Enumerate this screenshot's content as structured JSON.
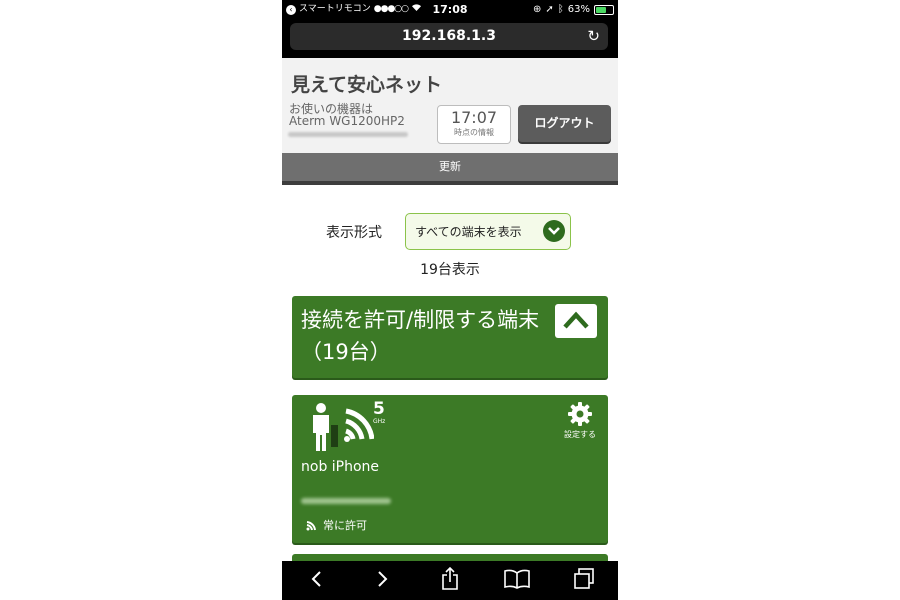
{
  "status_bar": {
    "back_app": "スマートリモコン",
    "signal": "●●●○○",
    "time": "17:08",
    "battery": "63%",
    "battery_level": 0.63
  },
  "address_bar": {
    "url": "192.168.1.3"
  },
  "header": {
    "title": "見えて安心ネット",
    "device_label": "お使いの機器は",
    "device_name": "Aterm WG1200HP2",
    "info_time": "17:07",
    "info_caption": "時点の情報",
    "logout_label": "ログアウト",
    "update_label": "更新"
  },
  "display": {
    "format_label": "表示形式",
    "format_value": "すべての端末を表示",
    "count_text": "19台表示"
  },
  "section": {
    "title": "接続を許可/制限する端末（19台）"
  },
  "device_card": {
    "band": "5",
    "band_unit": "GHz",
    "settings_label": "設定する",
    "name": "nob iPhone",
    "status": "常に許可"
  },
  "colors": {
    "green": "#3c7a26",
    "dark": "#000000",
    "header_bg": "#f2f2f2",
    "logout_bg": "#5c5c5c"
  }
}
